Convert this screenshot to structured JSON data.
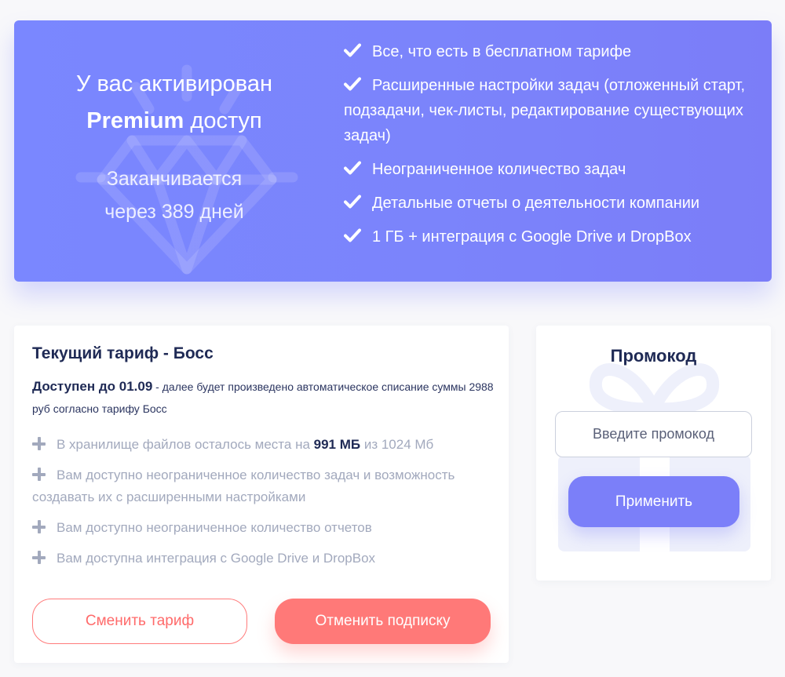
{
  "banner": {
    "activated_text": "У вас активирован",
    "premium_word": "Premium",
    "access_word": " доступ",
    "expires_text": "Заканчивается",
    "days_text": "через 389 дней",
    "features": [
      "Все, что есть в бесплатном тарифе",
      "Расширенные настройки задач (отложенный старт, подзадачи, чек-листы, редактирование существующих задач)",
      "Неограниченное количество задач",
      "Детальные отчеты о деятельности компании",
      "1 ГБ + интеграция с Google Drive и DropBox"
    ],
    "check_icon": "check-icon",
    "background_icon": "diamond-icon"
  },
  "tariff": {
    "title": "Текущий тариф - Босс",
    "available_until": "Доступен до 01.09",
    "available_note": " - далее будет произведено автоматическое списание суммы 2988 руб согласно тарифу Босс",
    "storage": {
      "prefix": "В хранилище файлов осталось места на ",
      "value": "991 МБ",
      "suffix": " из 1024 Мб"
    },
    "perks": [
      "Вам доступно неограниченное количество задач и возможность создавать их с расширенными настройками",
      "Вам доступно неограниченное количество отчетов",
      "Вам доступна интеграция с Google Drive и DropBox"
    ],
    "change_button": "Сменить тариф",
    "cancel_button": "Отменить подписку"
  },
  "promo": {
    "title": "Промокод",
    "placeholder": "Введите промокод",
    "apply_button": "Применить",
    "background_icon": "gift-icon"
  },
  "colors": {
    "banner": "#7b84fb",
    "accent_red": "#ff7978",
    "accent_violet": "#7b7ff9",
    "heading": "#1f2a55",
    "muted": "#a2a9bd"
  }
}
